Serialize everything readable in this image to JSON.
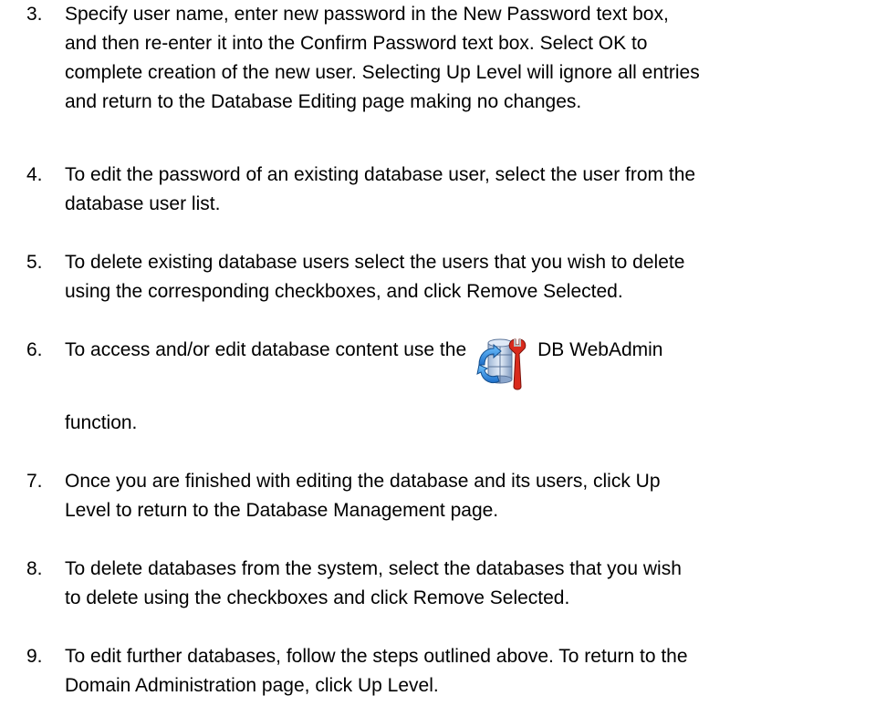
{
  "steps": [
    {
      "number": "3.",
      "lines": [
        "Specify user name, enter new password in the New Password text box,",
        "and then re-enter it into the Confirm Password text box. Select OK to",
        "complete creation of the new user. Selecting Up Level will ignore all entries",
        "and return to the Database Editing page making no changes."
      ]
    },
    {
      "number": "4.",
      "lines": [
        "To edit the password of an existing database user, select the user from the",
        "database user list."
      ]
    },
    {
      "number": "5.",
      "lines": [
        "To delete existing database users select the users that you wish to delete",
        "using the corresponding checkboxes, and click Remove Selected."
      ]
    },
    {
      "number": "6.",
      "before_icon": "To access and/or edit database content use the",
      "icon": "db-webadmin-icon",
      "after_icon": "DB WebAdmin",
      "continuation": "function."
    },
    {
      "number": "7.",
      "lines": [
        "Once you are finished with editing the database and its users, click Up",
        "Level to return to the Database Management page."
      ]
    },
    {
      "number": "8.",
      "lines": [
        "To delete databases from the system, select the databases that you wish",
        "to delete using the checkboxes and click Remove Selected."
      ]
    },
    {
      "number": "9.",
      "lines": [
        "To edit further databases, follow the steps outlined above. To return to the",
        "Domain Administration page, click Up Level."
      ]
    }
  ]
}
